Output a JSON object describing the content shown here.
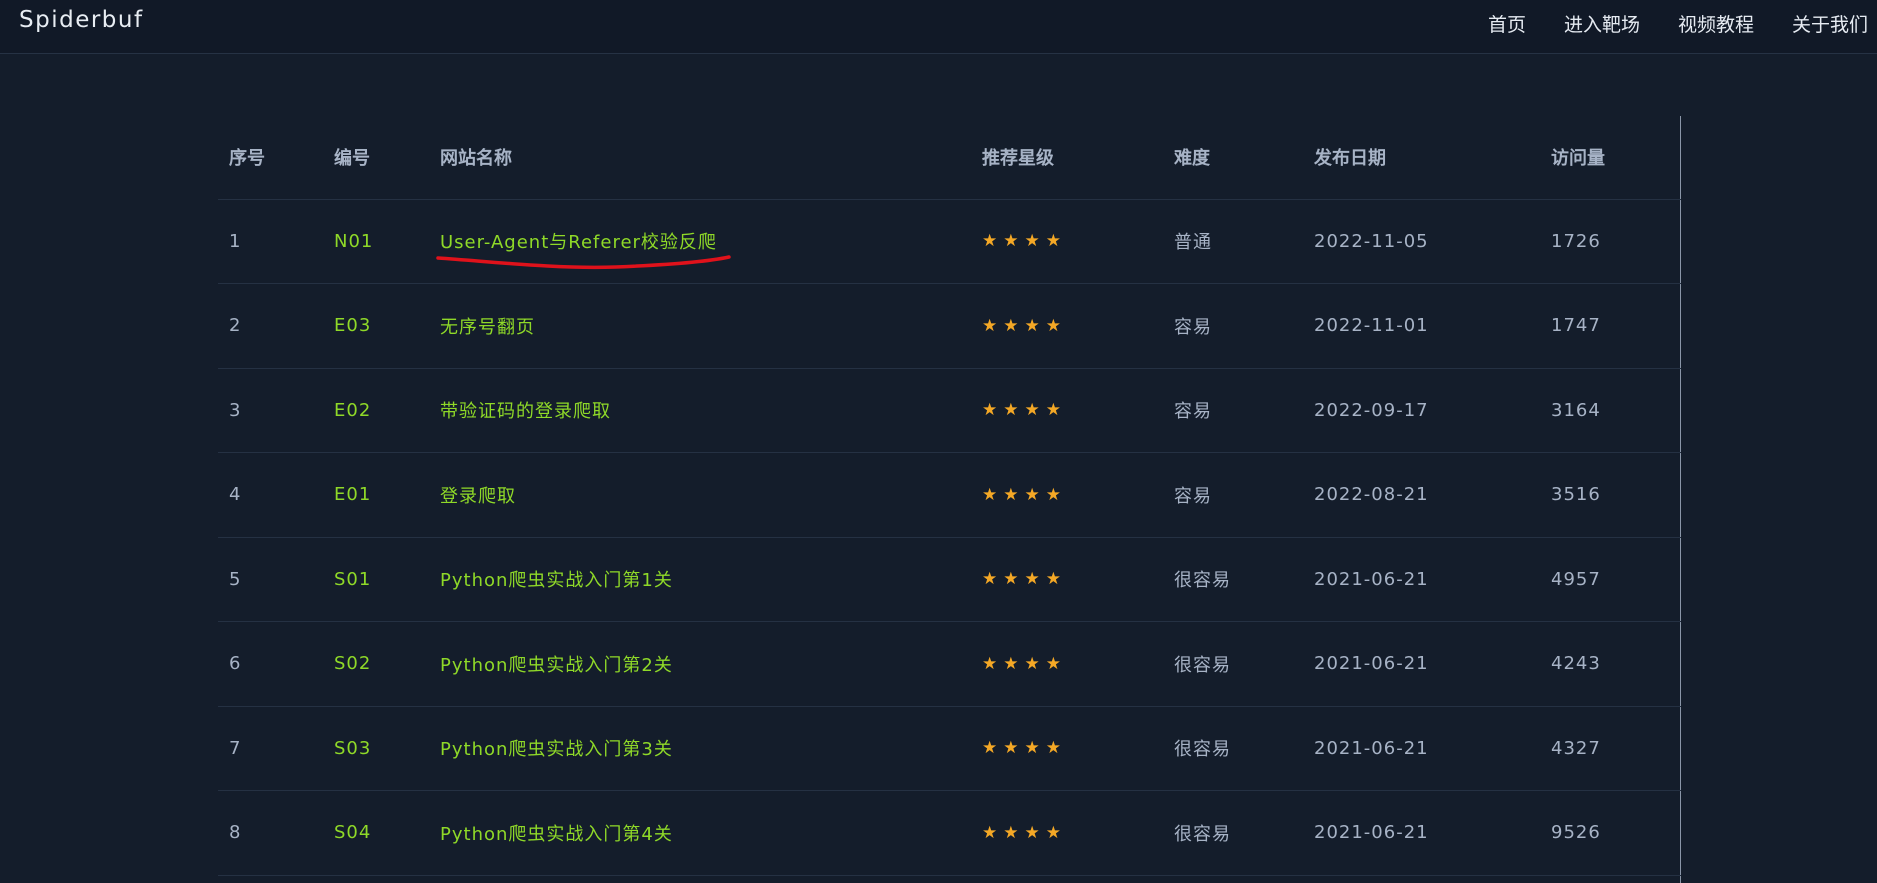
{
  "nav": {
    "brand": "Spiderbuf",
    "links": [
      "首页",
      "进入靶场",
      "视频教程",
      "关于我们"
    ]
  },
  "table": {
    "headers": [
      "序号",
      "编号",
      "网站名称",
      "推荐星级",
      "难度",
      "发布日期",
      "访问量"
    ],
    "rows": [
      {
        "index": "1",
        "code": "N01",
        "name": "User-Agent与Referer校验反爬",
        "stars": "★★★★",
        "difficulty": "普通",
        "date": "2022-11-05",
        "visits": "1726"
      },
      {
        "index": "2",
        "code": "E03",
        "name": "无序号翻页",
        "stars": "★★★★",
        "difficulty": "容易",
        "date": "2022-11-01",
        "visits": "1747"
      },
      {
        "index": "3",
        "code": "E02",
        "name": "带验证码的登录爬取",
        "stars": "★★★★",
        "difficulty": "容易",
        "date": "2022-09-17",
        "visits": "3164"
      },
      {
        "index": "4",
        "code": "E01",
        "name": "登录爬取",
        "stars": "★★★★",
        "difficulty": "容易",
        "date": "2022-08-21",
        "visits": "3516"
      },
      {
        "index": "5",
        "code": "S01",
        "name": "Python爬虫实战入门第1关",
        "stars": "★★★★",
        "difficulty": "很容易",
        "date": "2021-06-21",
        "visits": "4957"
      },
      {
        "index": "6",
        "code": "S02",
        "name": "Python爬虫实战入门第2关",
        "stars": "★★★★",
        "difficulty": "很容易",
        "date": "2021-06-21",
        "visits": "4243"
      },
      {
        "index": "7",
        "code": "S03",
        "name": "Python爬虫实战入门第3关",
        "stars": "★★★★",
        "difficulty": "很容易",
        "date": "2021-06-21",
        "visits": "4327"
      },
      {
        "index": "8",
        "code": "S04",
        "name": "Python爬虫实战入门第4关",
        "stars": "★★★★",
        "difficulty": "很容易",
        "date": "2021-06-21",
        "visits": "9526"
      }
    ]
  },
  "colors": {
    "background": "#141d2b",
    "link": "#8fd928",
    "star": "#f4a826",
    "annotation": "#e0121b"
  }
}
